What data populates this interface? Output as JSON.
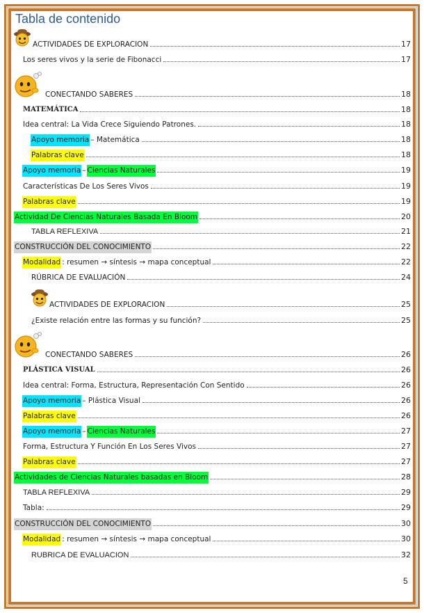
{
  "document": {
    "title": "Tabla de contenido",
    "page_number": "5"
  },
  "toc": [
    {
      "key": "e01",
      "label": "ACTIVIDADES DE EXPLORACION",
      "page": "17",
      "icon": "explorer-face-icon"
    },
    {
      "key": "e02",
      "label": "Los seres vivos y la serie de Fibonacci",
      "page": "17"
    },
    {
      "key": "e03",
      "label": "CONECTANDO SABERES",
      "page": "18",
      "icon": "thinking-face-icon"
    },
    {
      "key": "e04",
      "label": "MATEMÁTICA",
      "page": "18"
    },
    {
      "key": "e05",
      "label": "Idea central: La Vida Crece Siguiendo Patrones.",
      "page": "18"
    },
    {
      "key": "e06",
      "parts": [
        "Apoyo memoria",
        " – Matemática"
      ],
      "page": "18"
    },
    {
      "key": "e07",
      "label": "Palabras clave",
      "page": "18"
    },
    {
      "key": "e08",
      "parts": [
        "Apoyo memoria",
        " – ",
        "Ciencias Naturales"
      ],
      "page": "19"
    },
    {
      "key": "e09",
      "label": "Características De Los Seres Vivos",
      "page": "19"
    },
    {
      "key": "e10",
      "label": "Palabras clave",
      "page": "19"
    },
    {
      "key": "e11",
      "label": "Actividad De Ciencias Naturales Basada En Bloom",
      "page": "20"
    },
    {
      "key": "e12",
      "label": "TABLA REFLEXIVA",
      "page": "21"
    },
    {
      "key": "e13",
      "label": "CONSTRUCCIÓN DEL CONOCIMIENTO",
      "page": "22"
    },
    {
      "key": "e14",
      "parts": [
        "Modalidad",
        ": resumen → síntesis → mapa conceptual"
      ],
      "page": "22"
    },
    {
      "key": "e15",
      "label": "RÚBRICA DE EVALUACIÓN",
      "page": "24"
    },
    {
      "key": "e16",
      "label": "ACTIVIDADES DE EXPLORACION",
      "page": "25",
      "icon": "explorer-face-icon"
    },
    {
      "key": "e17",
      "label": "¿Existe relación entre las formas y su función?",
      "page": "25"
    },
    {
      "key": "e18",
      "label": "CONECTANDO SABERES",
      "page": "26",
      "icon": "thinking-face-icon"
    },
    {
      "key": "e19",
      "label": "PLÁSTICA VISUAL",
      "page": "26"
    },
    {
      "key": "e20",
      "label": "Idea central: Forma, Estructura, Representación Con Sentido",
      "page": "26"
    },
    {
      "key": "e21",
      "parts": [
        "Apoyo memoria",
        " – Plástica Visual"
      ],
      "page": "26"
    },
    {
      "key": "e22",
      "label": "Palabras clave",
      "page": "26"
    },
    {
      "key": "e23",
      "parts": [
        "Apoyo memoria",
        " – ",
        "Ciencias Naturales"
      ],
      "page": "27"
    },
    {
      "key": "e24",
      "label": "Forma, Estructura Y Función En Los Seres Vivos",
      "page": "27"
    },
    {
      "key": "e25",
      "label": "Palabras clave",
      "page": "27"
    },
    {
      "key": "e26",
      "label": "Actividades de Ciencias Naturales basadas en Bloom",
      "page": "28"
    },
    {
      "key": "e27",
      "label": "TABLA REFLEXIVA",
      "page": "29"
    },
    {
      "key": "e28",
      "label": "Tabla:",
      "page": "29"
    },
    {
      "key": "e29",
      "label": "CONSTRUCCIÓN DEL CONOCIMIENTO",
      "page": "30"
    },
    {
      "key": "e30",
      "parts": [
        "Modalidad",
        ": resumen → síntesis → mapa conceptual"
      ],
      "page": "30"
    },
    {
      "key": "e31",
      "label": "RUBRICA DE EVALUACION",
      "page": "32"
    }
  ],
  "colors": {
    "border": "#c8782e",
    "title": "#2f5b94",
    "highlight_yellow": "#ffff00",
    "highlight_cyan": "#00e5ff",
    "highlight_green": "#00ff3c",
    "highlight_gray": "#d4d4d4"
  }
}
